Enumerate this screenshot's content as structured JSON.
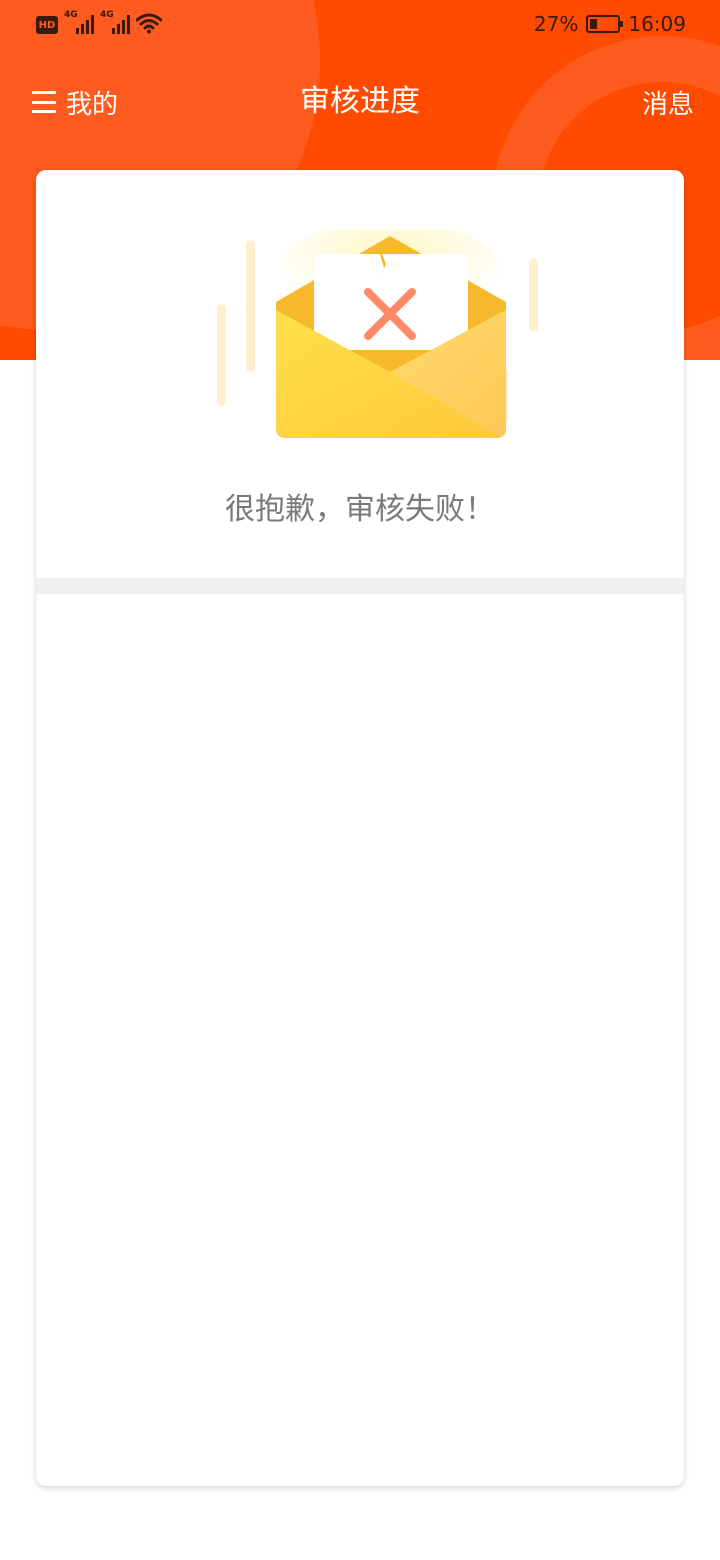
{
  "status_bar": {
    "hd_label": "HD",
    "network_1": "4G",
    "network_2": "4G",
    "battery_percent": "27%",
    "battery_level": 0.27,
    "time": "16:09"
  },
  "nav": {
    "menu_label": "我的",
    "title": "审核进度",
    "messages_label": "消息"
  },
  "result": {
    "icon": "broken-envelope-failed-icon",
    "message": "很抱歉，审核失败！"
  },
  "colors": {
    "header_orange": "#ff4a00",
    "header_highlight": "#ff5a1f",
    "envelope_yellow": "#ffd84a",
    "fail_x": "#ff8a6a",
    "text_gray": "#7a7a7a"
  }
}
